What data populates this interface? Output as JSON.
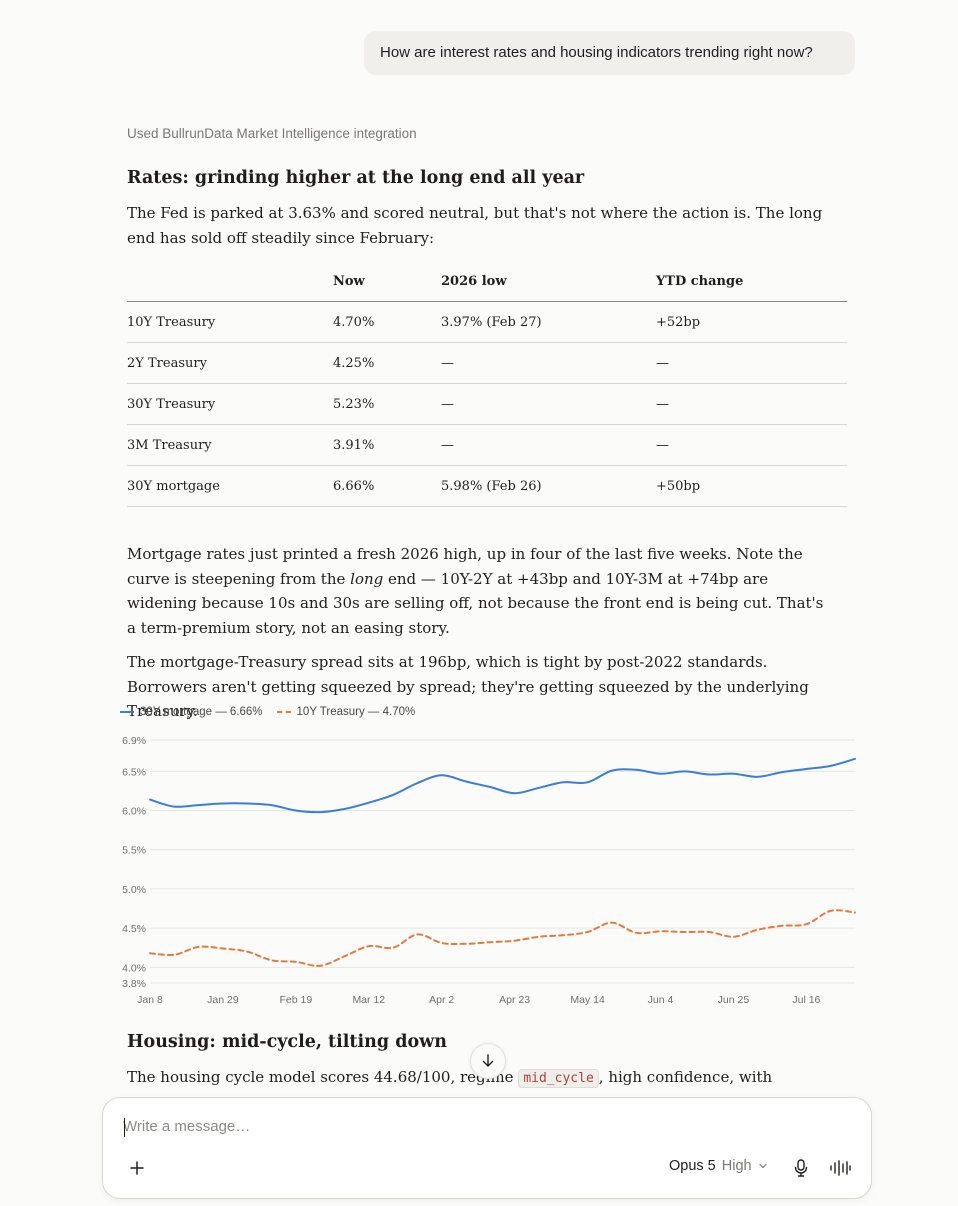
{
  "user_message": "How are interest rates and housing indicators trending right now?",
  "tool_used": "Used BullrunData Market Intelligence integration",
  "section1": {
    "heading": "Rates: grinding higher at the long end all year",
    "intro": "The Fed is parked at 3.63% and scored neutral, but that's not where the action is. The long end has sold off steadily since February:"
  },
  "rates_table": {
    "headers": [
      "",
      "Now",
      "2026 low",
      "YTD change"
    ],
    "rows": [
      [
        "10Y Treasury",
        "4.70%",
        "3.97% (Feb 27)",
        "+52bp"
      ],
      [
        "2Y Treasury",
        "4.25%",
        "—",
        "—"
      ],
      [
        "30Y Treasury",
        "5.23%",
        "—",
        "—"
      ],
      [
        "3M Treasury",
        "3.91%",
        "—",
        "—"
      ],
      [
        "30Y mortgage",
        "6.66%",
        "5.98% (Feb 26)",
        "+50bp"
      ]
    ]
  },
  "para2": {
    "before": "Mortgage rates just printed a fresh 2026 high, up in four of the last five weeks. Note the curve is steepening from the ",
    "em": "long",
    "after": " end — 10Y-2Y at +43bp and 10Y-3M at +74bp are widening because 10s and 30s are selling off, not because the front end is being cut. That's a term-premium story, not an easing story."
  },
  "para3": "The mortgage-Treasury spread sits at 196bp, which is tight by post-2022 standards. Borrowers aren't getting squeezed by spread; they're getting squeezed by the underlying Treasury.",
  "chart_data": {
    "type": "line",
    "title": "",
    "xlabel": "",
    "ylabel": "",
    "grid": true,
    "legend_position": "top-left",
    "y_ticks": [
      "6.9%",
      "6.5%",
      "6.0%",
      "5.5%",
      "5.0%",
      "4.5%",
      "4.0%",
      "3.8%"
    ],
    "y_tick_values": [
      6.9,
      6.5,
      6.0,
      5.5,
      5.0,
      4.5,
      4.0,
      3.8
    ],
    "ylim": [
      3.8,
      6.9
    ],
    "x_ticks": [
      "Jan 8",
      "Jan 29",
      "Feb 19",
      "Mar 12",
      "Apr 2",
      "Apr 23",
      "May 14",
      "Jun 4",
      "Jun 25",
      "Jul 16"
    ],
    "x": [
      "Jan 8",
      "Jan 15",
      "Jan 22",
      "Jan 29",
      "Feb 5",
      "Feb 12",
      "Feb 19",
      "Feb 26",
      "Mar 5",
      "Mar 12",
      "Mar 19",
      "Mar 26",
      "Apr 2",
      "Apr 9",
      "Apr 16",
      "Apr 23",
      "Apr 30",
      "May 7",
      "May 14",
      "May 21",
      "May 28",
      "Jun 4",
      "Jun 11",
      "Jun 18",
      "Jun 25",
      "Jul 2",
      "Jul 9",
      "Jul 16",
      "Jul 23",
      "Jul 30"
    ],
    "series": [
      {
        "name": "30Y mortgage — 6.66%",
        "color": "#3b7dd8",
        "dashed": false,
        "values": [
          6.14,
          6.05,
          6.07,
          6.09,
          6.09,
          6.07,
          6.0,
          5.98,
          6.02,
          6.1,
          6.2,
          6.35,
          6.45,
          6.37,
          6.3,
          6.22,
          6.29,
          6.36,
          6.36,
          6.51,
          6.52,
          6.47,
          6.5,
          6.46,
          6.47,
          6.43,
          6.49,
          6.53,
          6.57,
          6.66
        ]
      },
      {
        "name": "10Y Treasury — 4.70%",
        "color": "#e07a3f",
        "dashed": true,
        "values": [
          4.18,
          4.16,
          4.26,
          4.24,
          4.2,
          4.09,
          4.07,
          4.02,
          4.14,
          4.27,
          4.25,
          4.42,
          4.31,
          4.3,
          4.32,
          4.34,
          4.39,
          4.41,
          4.45,
          4.57,
          4.44,
          4.46,
          4.45,
          4.45,
          4.39,
          4.48,
          4.53,
          4.55,
          4.72,
          4.7
        ]
      }
    ]
  },
  "section2": {
    "heading": "Housing: mid-cycle, tilting down",
    "line_before": "The housing cycle model scores 44.68/100, regime ",
    "code": "mid_cycle",
    "line_after": ", high confidence, with"
  },
  "composer": {
    "placeholder": "Write a message…",
    "model": "Opus 5",
    "level": "High"
  },
  "colors": {
    "background": "#fbfbf9",
    "mortgage_line": "#3b7dd8",
    "treasury_line": "#e07a3f",
    "code_text": "#b0413e"
  },
  "icons": [
    "arrow-down-icon",
    "plus-icon",
    "chevron-down-icon",
    "microphone-icon",
    "voice-waveform-icon"
  ]
}
